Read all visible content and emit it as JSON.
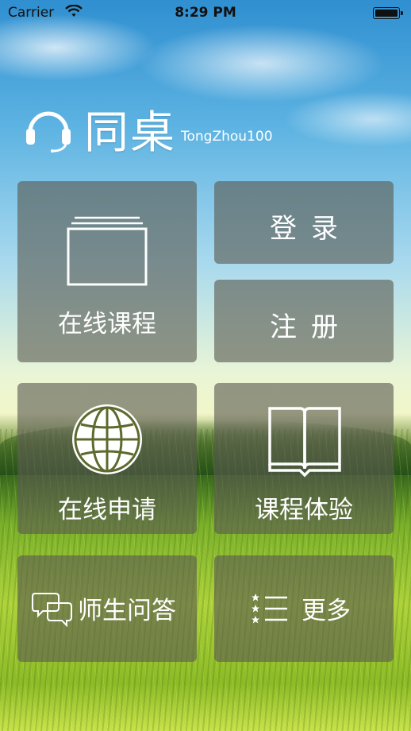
{
  "status_bar": {
    "carrier": "Carrier",
    "time": "8:29 PM",
    "wifi_icon": "wifi-icon",
    "battery_icon": "battery-icon"
  },
  "brand": {
    "title": "同桌",
    "subtitle": "TongZhou100",
    "logo_icon": "headphones-icon"
  },
  "tiles": {
    "courses": {
      "label": "在线课程",
      "icon": "course-stack-icon"
    },
    "login": {
      "label": "登录"
    },
    "register": {
      "label": "注册"
    },
    "apply": {
      "label": "在线申请",
      "icon": "globe-icon"
    },
    "trial": {
      "label": "课程体验",
      "icon": "book-icon"
    },
    "qa": {
      "label": "师生问答",
      "icon": "chat-bubbles-icon"
    },
    "more": {
      "label": "更多",
      "icon": "list-icon"
    }
  },
  "colors": {
    "tile_bg": "#5a5a50",
    "text": "#ffffff"
  }
}
